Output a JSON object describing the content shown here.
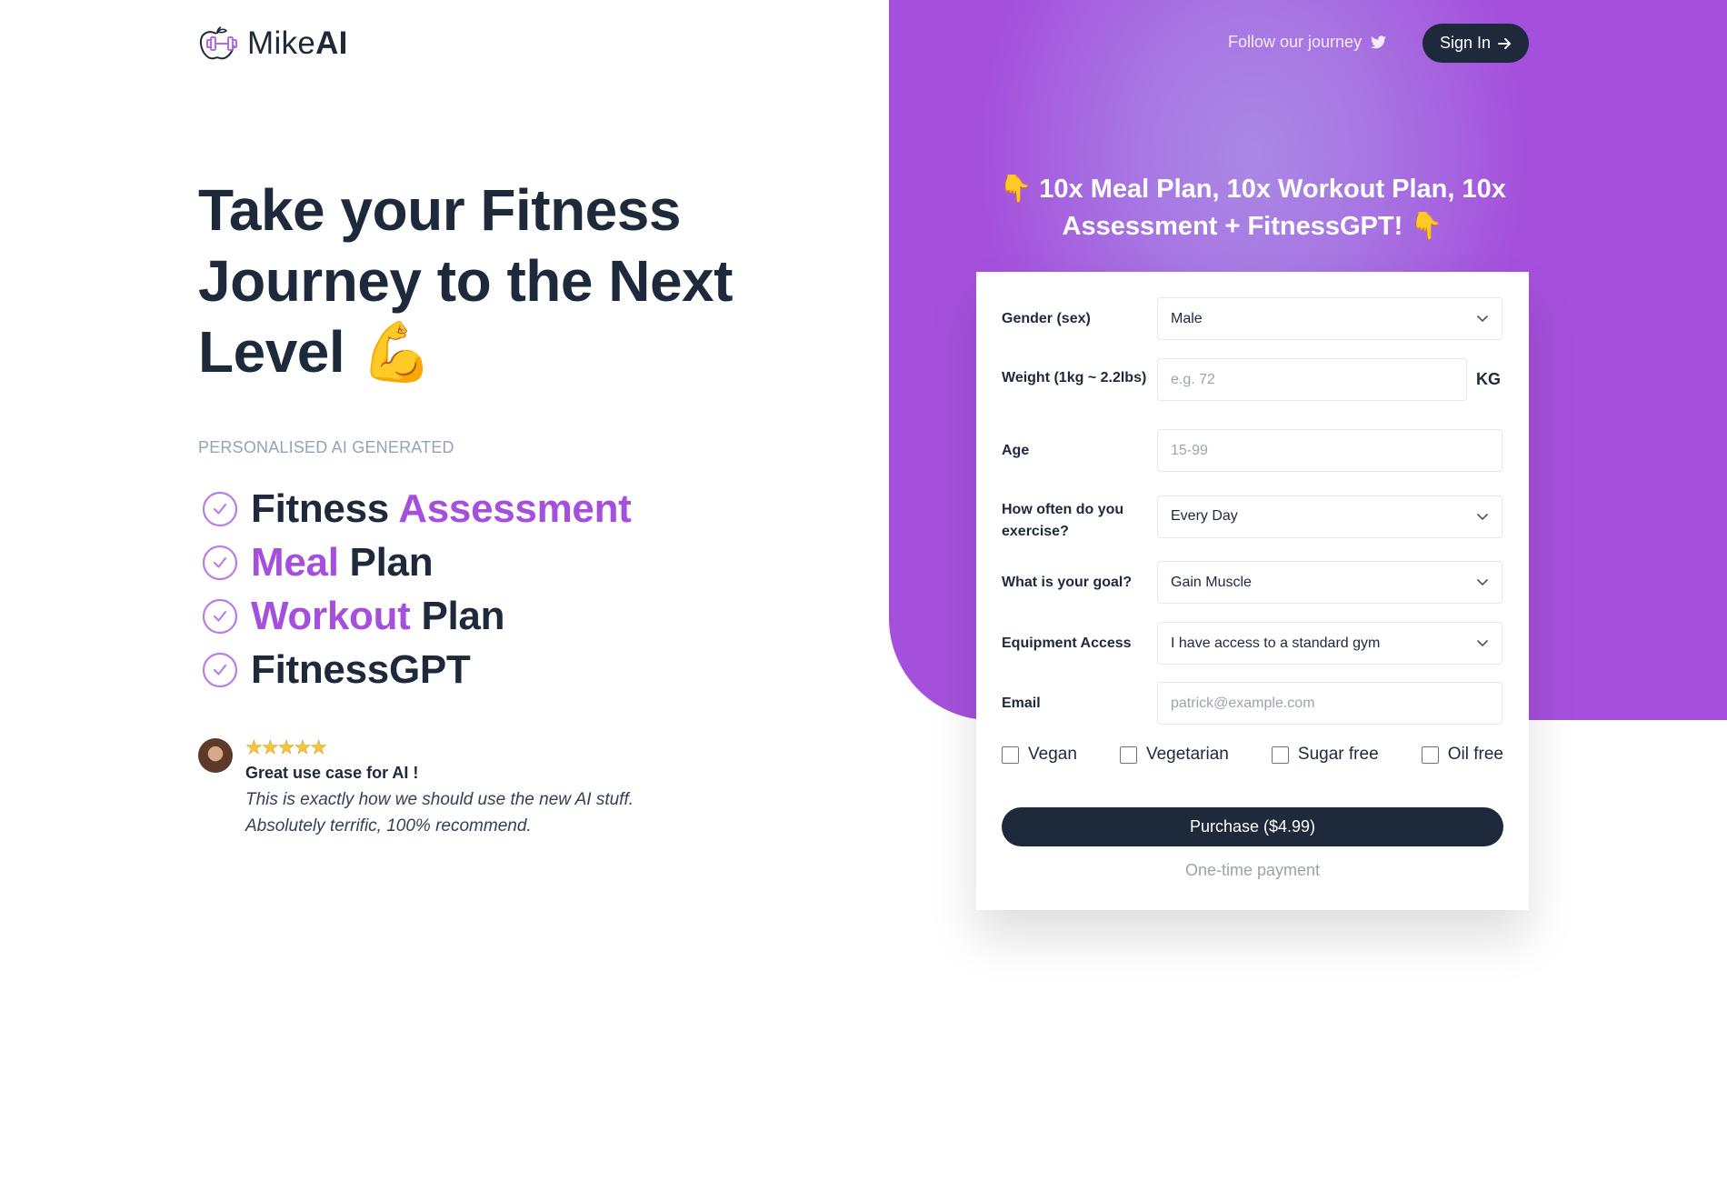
{
  "brand": {
    "name_prefix": "Mike",
    "name_suffix": "AI",
    "accent_color": "#a550dc",
    "dark_color": "#1e293b"
  },
  "nav": {
    "follow_label": "Follow our journey",
    "follow_icon": "twitter-icon",
    "signin_label": "Sign In",
    "signin_icon": "arrow-right-icon"
  },
  "hero": {
    "headline": "Take your Fitness Journey to the Next Level",
    "headline_emoji": "💪",
    "subheading": "PERSONALISED AI GENERATED",
    "features": [
      {
        "before": "Fitness ",
        "accent": "Assessment",
        "after": ""
      },
      {
        "before": "",
        "accent": "Meal",
        "after": " Plan"
      },
      {
        "before": "",
        "accent": "Workout",
        "after": " Plan"
      },
      {
        "before": "FitnessGPT",
        "accent": "",
        "after": ""
      }
    ]
  },
  "review": {
    "rating": 5,
    "rating_max": 5,
    "stars": "★★★★★",
    "title": "Great use case for AI !",
    "body_line1": "This is exactly how we should use the new AI stuff.",
    "body_line2": "Absolutely terrific, 100% recommend."
  },
  "promo": {
    "emoji": "👇",
    "line1": "10x Meal Plan, 10x Workout Plan, 10x",
    "line2": "Assessment + FitnessGPT!"
  },
  "form": {
    "gender": {
      "label": "Gender (sex)",
      "value": "Male"
    },
    "weight": {
      "label": "Weight (1kg ~ 2.2lbs)",
      "placeholder": "e.g. 72",
      "unit": "KG"
    },
    "age": {
      "label": "Age",
      "placeholder": "15-99"
    },
    "frequency": {
      "label": "How often do you exercise?",
      "value": "Every Day"
    },
    "goal": {
      "label": "What is your goal?",
      "value": "Gain Muscle"
    },
    "equipment": {
      "label": "Equipment Access",
      "value": "I have access to a standard gym"
    },
    "email": {
      "label": "Email",
      "placeholder": "patrick@example.com"
    },
    "diets": [
      {
        "label": "Vegan",
        "checked": false
      },
      {
        "label": "Vegetarian",
        "checked": false
      },
      {
        "label": "Sugar free",
        "checked": false
      },
      {
        "label": "Oil free",
        "checked": false
      }
    ],
    "purchase_label": "Purchase ($4.99)",
    "payment_note": "One-time payment"
  }
}
